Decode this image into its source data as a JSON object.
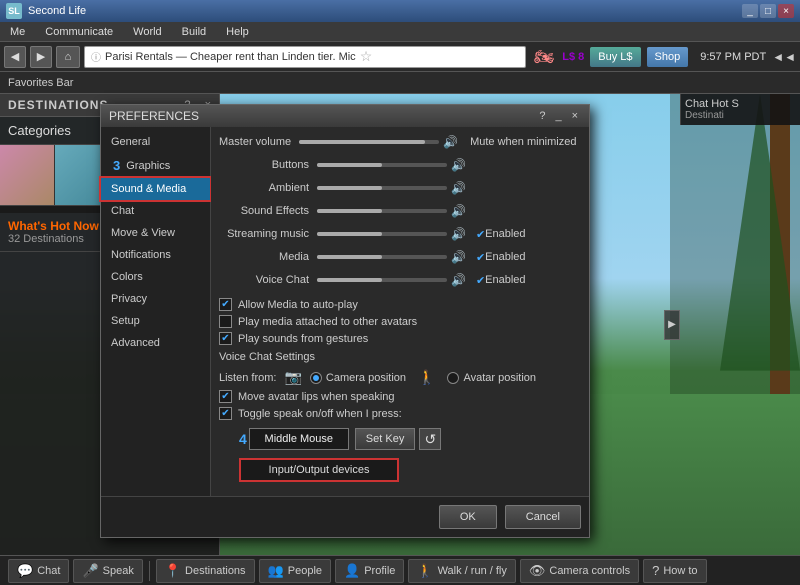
{
  "titleBar": {
    "title": "Second Life",
    "logo": "SL",
    "controls": [
      "_",
      "□",
      "×"
    ]
  },
  "menuBar": {
    "items": [
      "Me",
      "Communicate",
      "World",
      "Build",
      "Help"
    ]
  },
  "toolbar": {
    "navBack": "◀",
    "navForward": "▶",
    "home": "⌂",
    "addressText": "Parisi Rentals — Cheaper rent than Linden tier. Mic",
    "addressIcon": "ⓘ",
    "linden": "L$ 8",
    "buyLinden": "Buy L$",
    "shop": "Shop",
    "time": "9:57 PM PDT",
    "audioIcon": "◄◄"
  },
  "favoritesBar": {
    "label": "Favorites Bar"
  },
  "destinations": {
    "title": "DESTINATIONS",
    "categories": "Categories",
    "whatsHot": {
      "title": "What's Hot Now",
      "subtitle": "32 Destinations"
    }
  },
  "preferences": {
    "title": "PREFERENCES",
    "helpBtn": "?",
    "minimizeBtn": "_",
    "closeBtn": "×",
    "navItems": [
      {
        "label": "General",
        "active": false
      },
      {
        "label": "Graphics",
        "num": "3",
        "active": false
      },
      {
        "label": "Sound & Media",
        "active": true
      },
      {
        "label": "Chat",
        "active": false
      },
      {
        "label": "Move & View",
        "active": false
      },
      {
        "label": "Notifications",
        "active": false
      },
      {
        "label": "Colors",
        "active": false
      },
      {
        "label": "Privacy",
        "active": false
      },
      {
        "label": "Setup",
        "active": false
      },
      {
        "label": "Advanced",
        "active": false
      }
    ],
    "content": {
      "masterVolume": "Master volume",
      "muteWhenMinimized": "Mute when minimized",
      "rows": [
        {
          "label": "Buttons"
        },
        {
          "label": "Ambient"
        },
        {
          "label": "Sound Effects"
        },
        {
          "label": "Streaming music",
          "rightLabel": "Enabled"
        },
        {
          "label": "Media",
          "rightLabel": "Enabled"
        },
        {
          "label": "Voice Chat",
          "rightLabel": "Enabled"
        }
      ],
      "checkboxes": [
        {
          "label": "Allow Media to auto-play",
          "checked": true
        },
        {
          "label": "Play media attached to other avatars",
          "checked": false
        },
        {
          "label": "Play sounds from gestures",
          "checked": true
        }
      ],
      "voiceChatSettings": "Voice Chat Settings",
      "listenFrom": "Listen from:",
      "cameraPosition": "Camera position",
      "avatarPosition": "Avatar position",
      "moveAvatarLips": "Move avatar lips when speaking",
      "toggleSpeak": "Toggle speak on/off when I press:",
      "middleMouse": "Middle Mouse",
      "setKey": "Set Key",
      "refresh": "↺",
      "inputOutput": "Input/Output devices",
      "numBadge4": "4"
    },
    "footer": {
      "ok": "OK",
      "cancel": "Cancel"
    }
  },
  "taskbar": {
    "items": [
      {
        "label": "Chat",
        "icon": "💬"
      },
      {
        "label": "Speak",
        "icon": "🎤"
      },
      {
        "label": "Destinations",
        "icon": "📍"
      },
      {
        "label": "People",
        "icon": "👥"
      },
      {
        "label": "Profile",
        "icon": "👤"
      },
      {
        "label": "Walk / run / fly",
        "icon": "🚶"
      },
      {
        "label": "Camera controls",
        "icon": "👁"
      },
      {
        "label": "How to",
        "icon": "?"
      }
    ]
  },
  "chatHot": {
    "title": "Chat Hot S",
    "subtitle": "Destinati"
  }
}
